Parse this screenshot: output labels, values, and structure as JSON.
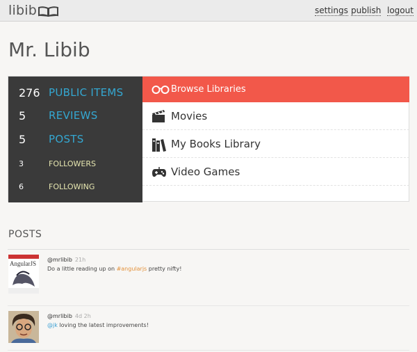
{
  "header": {
    "brand": "libib",
    "nav": {
      "settings": "settings",
      "publish": "publish",
      "logout": "logout"
    }
  },
  "profile": {
    "name": "Mr. Libib",
    "stats": [
      {
        "count": "276",
        "label": "PUBLIC ITEMS"
      },
      {
        "count": "5",
        "label": "REVIEWS"
      },
      {
        "count": "5",
        "label": "POSTS"
      },
      {
        "count": "3",
        "label": "FOLLOWERS"
      },
      {
        "count": "6",
        "label": "FOLLOWING"
      }
    ]
  },
  "libraries": {
    "browse_label": "Browse Libraries",
    "items": [
      {
        "label": "Movies",
        "icon": "clapperboard-icon"
      },
      {
        "label": "My Books Library",
        "icon": "books-icon"
      },
      {
        "label": "Video Games",
        "icon": "gamepad-icon"
      }
    ]
  },
  "posts": {
    "heading": "POSTS",
    "items": [
      {
        "handle": "@mrlibib",
        "time": "21h",
        "text_before": "Do a little reading up on ",
        "tag": "#angularjs",
        "text_after": " pretty nifty!",
        "thumb_title": "AngularJS"
      },
      {
        "handle": "@mrlibib",
        "time": "4d 2h",
        "mention": "@jk",
        "text_after": " loving the latest improvements!"
      }
    ]
  },
  "colors": {
    "accent_red": "#f2584a",
    "stat_blue": "#34a7d1",
    "dark_panel": "#3a3a3a",
    "tag_orange": "#e3913a"
  }
}
